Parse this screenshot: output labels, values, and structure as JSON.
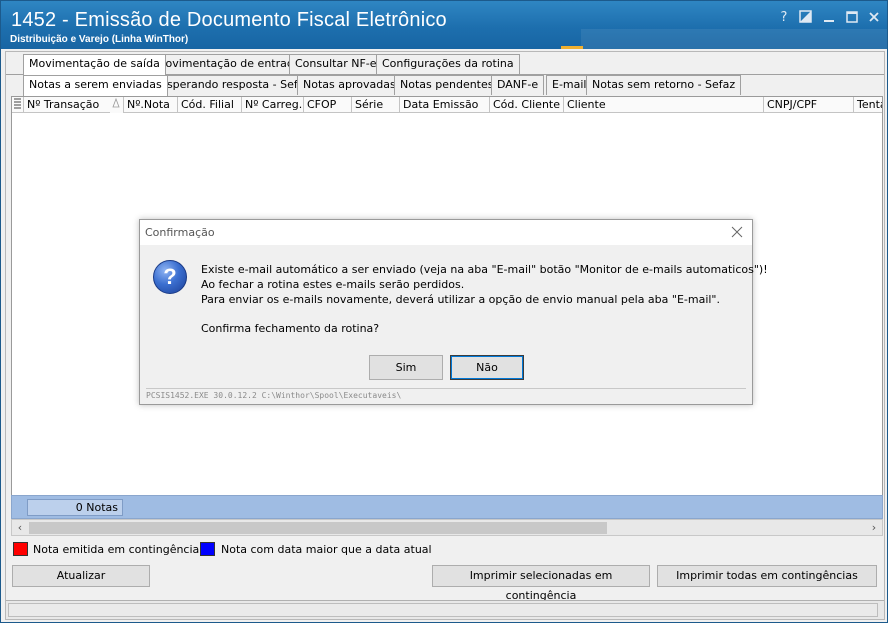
{
  "window": {
    "title": "1452 - Emissão de Documento Fiscal Eletrônico",
    "subtitle": "Distribuição e Varejo (Linha WinThor)",
    "controls": [
      "help-icon",
      "restore-icon",
      "minimize-icon",
      "maximize-icon",
      "close-icon"
    ]
  },
  "tabs_top": [
    {
      "label": "Movimentação de saída",
      "active": true
    },
    {
      "label": "Movimentação de entrada"
    },
    {
      "label": "Consultar NF-e"
    },
    {
      "label": "Configurações da rotina"
    }
  ],
  "tabs_sub": [
    {
      "label": "Notas a serem enviadas",
      "active": true
    },
    {
      "label": "Esperando resposta - Sefaz"
    },
    {
      "label": "Notas aprovadas"
    },
    {
      "label": "Notas pendentes"
    },
    {
      "label": "DANF-e"
    },
    {
      "label": "E-mail"
    },
    {
      "label": "Notas sem retorno - Sefaz"
    }
  ],
  "grid": {
    "columns": [
      "Nº Transação",
      "Nº.Nota",
      "Cód. Filial",
      "Nº Carreg.",
      "CFOP",
      "Série",
      "Data Emissão",
      "Cód. Cliente",
      "Cliente",
      "CNPJ/CPF",
      "Tenta"
    ],
    "count_label": "0 Notas"
  },
  "legend": [
    {
      "label": "Nota emitida em contingência",
      "color": "#ff0000"
    },
    {
      "label": "Nota com data maior que a data atual",
      "color": "#0000ff"
    }
  ],
  "buttons": {
    "atualizar": "Atualizar",
    "imprimir_selecionadas": "Imprimir selecionadas em contingência",
    "imprimir_todas": "Imprimir todas em contingências"
  },
  "dialog": {
    "title": "Confirmação",
    "lines": [
      "Existe e-mail automático a ser enviado (veja na aba \"E-mail\" botão \"Monitor de e-mails automaticos\")!",
      "Ao fechar a rotina estes e-mails serão perdidos.",
      "Para enviar os e-mails novamente, deverá utilizar a opção de envio manual pela aba \"E-mail\".",
      "Confirma fechamento da rotina?"
    ],
    "yes_label": "Sim",
    "no_label": "Não",
    "footer": "PCSIS1452.EXE 30.0.12.2  C:\\Winthor\\Spool\\Executaveis\\"
  }
}
